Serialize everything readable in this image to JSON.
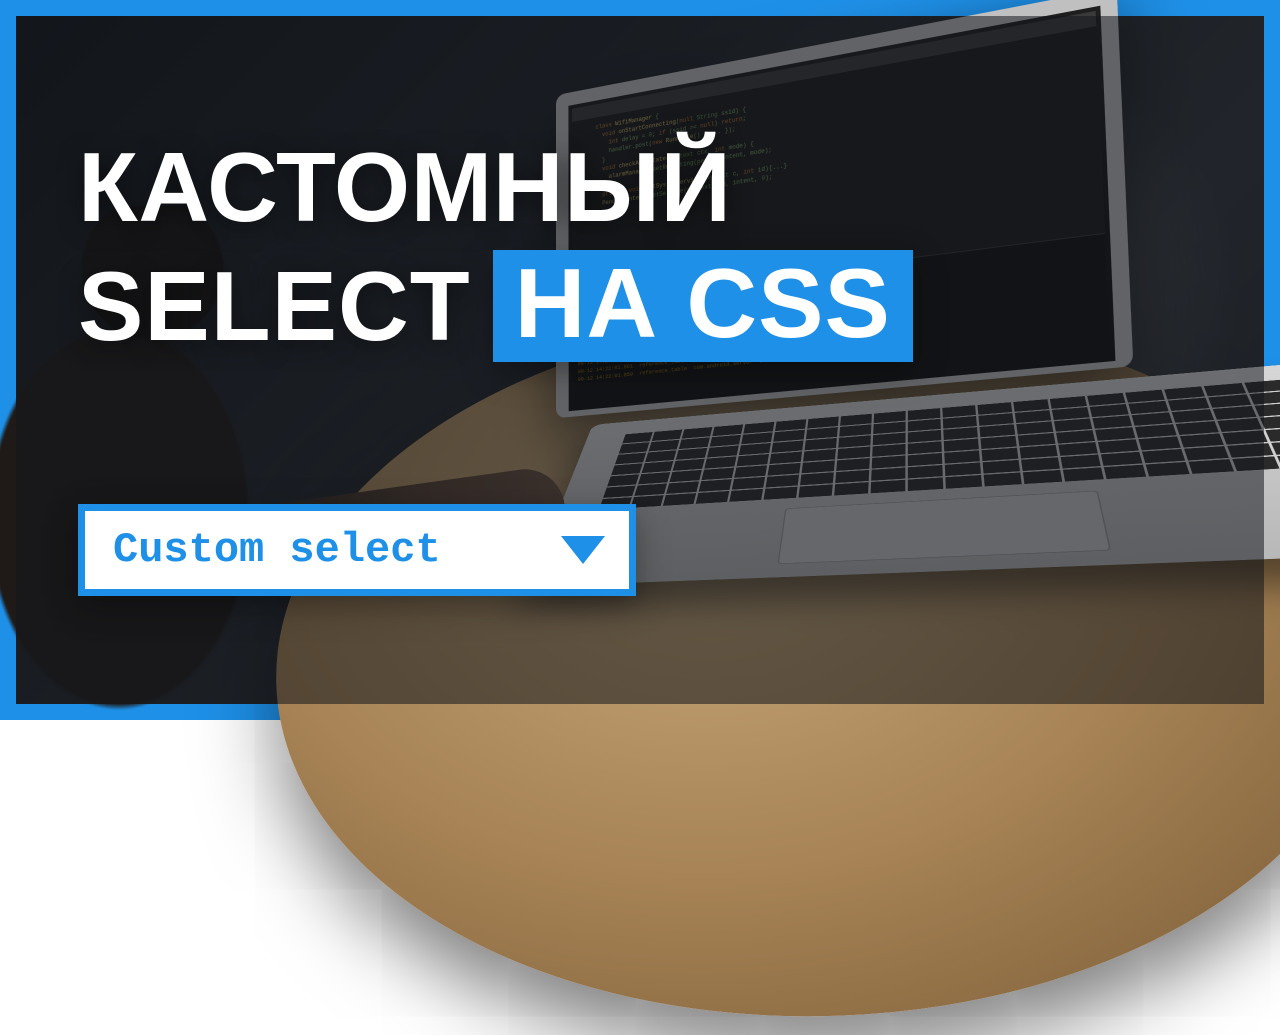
{
  "brand_color": "#1e90e8",
  "title": {
    "line1": "КАСТОМНЫЙ",
    "line2a": "SELECT",
    "line2b": "НА CSS"
  },
  "select": {
    "label": "Custom select"
  }
}
